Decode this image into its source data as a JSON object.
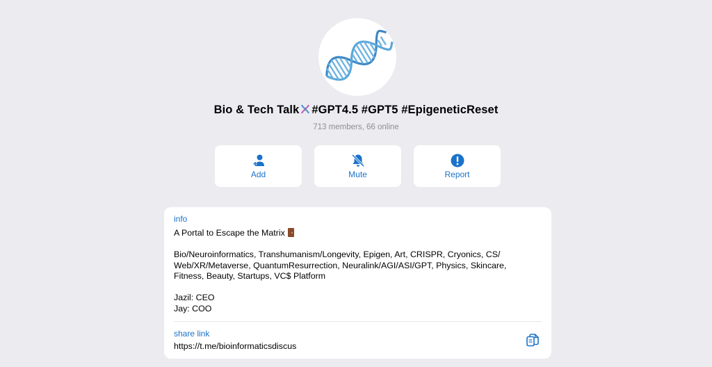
{
  "group": {
    "title": "Bio & Tech Talk",
    "hashtags": "#GPT4.5 #GPT5 #EpigeneticReset",
    "dna_emoji_icon": "dna-icon",
    "members": "713 members, 66 online"
  },
  "actions": [
    {
      "label": "Add",
      "icon": "add-user-icon"
    },
    {
      "label": "Mute",
      "icon": "bell-muted-icon"
    },
    {
      "label": "Report",
      "icon": "exclamation-circle-icon"
    }
  ],
  "info": {
    "heading": "info",
    "tagline": "A Portal to Escape the Matrix",
    "tagline_icon": "door-icon",
    "topics_line1": "Bio/Neuroinformatics, Transhumanism/Longevity, Epigen, Art, CRISPR, Cryonics, CS/",
    "topics_line2": "Web/XR/Metaverse, QuantumResurrection, Neuralink/AGI/ASI/GPT, Physics, Skincare,",
    "topics_line3": "Fitness, Beauty, Startups, VC$ Platform",
    "role1": "Jazil: CEO",
    "role2": "Jay: COO"
  },
  "share": {
    "heading": "share link",
    "url": "https://t.me/bioinformaticsdiscus",
    "copy_icon": "copy-icon"
  },
  "colors": {
    "accent": "#1b72c9",
    "background": "#ebebf0",
    "card": "#ffffff",
    "muted_text": "#8e8e93"
  }
}
